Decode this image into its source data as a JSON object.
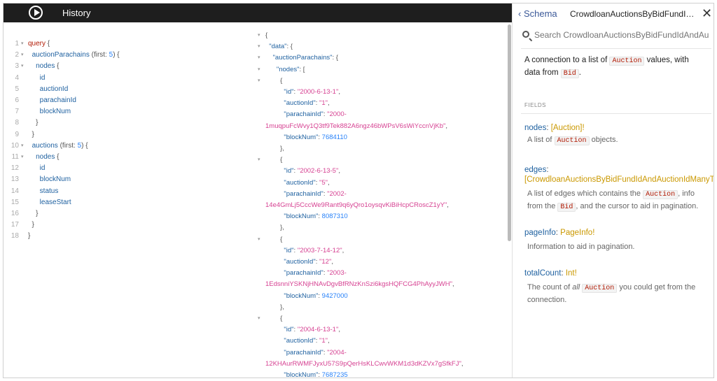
{
  "toolbar": {
    "history_label": "History"
  },
  "query_lines": [
    {
      "n": "1",
      "fold": "▾",
      "parts": [
        [
          "kw",
          "query"
        ],
        [
          "punct",
          " {"
        ]
      ]
    },
    {
      "n": "2",
      "fold": "▾",
      "parts": [
        [
          "punct",
          "  "
        ],
        [
          "field",
          "auctionParachains"
        ],
        [
          "punct",
          " (first: "
        ],
        [
          "num",
          "5"
        ],
        [
          "punct",
          ") {"
        ]
      ]
    },
    {
      "n": "3",
      "fold": "▾",
      "parts": [
        [
          "punct",
          "    "
        ],
        [
          "field",
          "nodes"
        ],
        [
          "punct",
          " {"
        ]
      ]
    },
    {
      "n": "4",
      "fold": "",
      "parts": [
        [
          "punct",
          "      "
        ],
        [
          "field",
          "id"
        ]
      ]
    },
    {
      "n": "5",
      "fold": "",
      "parts": [
        [
          "punct",
          "      "
        ],
        [
          "field",
          "auctionId"
        ]
      ]
    },
    {
      "n": "6",
      "fold": "",
      "parts": [
        [
          "punct",
          "      "
        ],
        [
          "field",
          "parachainId"
        ]
      ]
    },
    {
      "n": "7",
      "fold": "",
      "parts": [
        [
          "punct",
          "      "
        ],
        [
          "field",
          "blockNum"
        ]
      ]
    },
    {
      "n": "8",
      "fold": "",
      "parts": [
        [
          "punct",
          "    }"
        ]
      ]
    },
    {
      "n": "9",
      "fold": "",
      "parts": [
        [
          "punct",
          "  }"
        ]
      ]
    },
    {
      "n": "10",
      "fold": "▾",
      "parts": [
        [
          "punct",
          "  "
        ],
        [
          "field",
          "auctions"
        ],
        [
          "punct",
          " (first: "
        ],
        [
          "num",
          "5"
        ],
        [
          "punct",
          ") {"
        ]
      ]
    },
    {
      "n": "11",
      "fold": "▾",
      "parts": [
        [
          "punct",
          "    "
        ],
        [
          "field",
          "nodes"
        ],
        [
          "punct",
          " {"
        ]
      ]
    },
    {
      "n": "12",
      "fold": "",
      "parts": [
        [
          "punct",
          "      "
        ],
        [
          "field",
          "id"
        ]
      ]
    },
    {
      "n": "13",
      "fold": "",
      "parts": [
        [
          "punct",
          "      "
        ],
        [
          "field",
          "blockNum"
        ]
      ]
    },
    {
      "n": "14",
      "fold": "",
      "parts": [
        [
          "punct",
          "      "
        ],
        [
          "field",
          "status"
        ]
      ]
    },
    {
      "n": "15",
      "fold": "",
      "parts": [
        [
          "punct",
          "      "
        ],
        [
          "field",
          "leaseStart"
        ]
      ]
    },
    {
      "n": "16",
      "fold": "",
      "parts": [
        [
          "punct",
          "    }"
        ]
      ]
    },
    {
      "n": "17",
      "fold": "",
      "parts": [
        [
          "punct",
          "  }"
        ]
      ]
    },
    {
      "n": "18",
      "fold": "",
      "parts": [
        [
          "punct",
          "}"
        ]
      ]
    }
  ],
  "result_lines": [
    {
      "fold": "▾",
      "parts": [
        [
          "p",
          "{"
        ]
      ]
    },
    {
      "fold": "▾",
      "parts": [
        [
          "p",
          "  "
        ],
        [
          "key",
          "\"data\""
        ],
        [
          "p",
          ": {"
        ]
      ]
    },
    {
      "fold": "▾",
      "parts": [
        [
          "p",
          "    "
        ],
        [
          "key",
          "\"auctionParachains\""
        ],
        [
          "p",
          ": {"
        ]
      ]
    },
    {
      "fold": "▾",
      "parts": [
        [
          "p",
          "      "
        ],
        [
          "key",
          "\"nodes\""
        ],
        [
          "p",
          ": ["
        ]
      ]
    },
    {
      "fold": "▾",
      "parts": [
        [
          "p",
          "        {"
        ]
      ]
    },
    {
      "fold": "",
      "parts": [
        [
          "p",
          "          "
        ],
        [
          "key",
          "\"id\""
        ],
        [
          "p",
          ": "
        ],
        [
          "str",
          "\"2000-6-13-1\""
        ],
        [
          "p",
          ","
        ]
      ]
    },
    {
      "fold": "",
      "parts": [
        [
          "p",
          "          "
        ],
        [
          "key",
          "\"auctionId\""
        ],
        [
          "p",
          ": "
        ],
        [
          "str",
          "\"1\""
        ],
        [
          "p",
          ","
        ]
      ]
    },
    {
      "fold": "",
      "parts": [
        [
          "p",
          "          "
        ],
        [
          "key",
          "\"parachainId\""
        ],
        [
          "p",
          ": "
        ],
        [
          "str",
          "\"2000-"
        ]
      ]
    },
    {
      "fold": "",
      "parts": [
        [
          "str",
          "1muqpuFcWvy1Q3tf9Tek882A6ngz46bWPsV6sWiYccnVjKb\""
        ],
        [
          "p",
          ","
        ]
      ]
    },
    {
      "fold": "",
      "parts": [
        [
          "p",
          "          "
        ],
        [
          "key",
          "\"blockNum\""
        ],
        [
          "p",
          ": "
        ],
        [
          "num",
          "7684110"
        ]
      ]
    },
    {
      "fold": "",
      "parts": [
        [
          "p",
          "        },"
        ]
      ]
    },
    {
      "fold": "▾",
      "parts": [
        [
          "p",
          "        {"
        ]
      ]
    },
    {
      "fold": "",
      "parts": [
        [
          "p",
          "          "
        ],
        [
          "key",
          "\"id\""
        ],
        [
          "p",
          ": "
        ],
        [
          "str",
          "\"2002-6-13-5\""
        ],
        [
          "p",
          ","
        ]
      ]
    },
    {
      "fold": "",
      "parts": [
        [
          "p",
          "          "
        ],
        [
          "key",
          "\"auctionId\""
        ],
        [
          "p",
          ": "
        ],
        [
          "str",
          "\"5\""
        ],
        [
          "p",
          ","
        ]
      ]
    },
    {
      "fold": "",
      "parts": [
        [
          "p",
          "          "
        ],
        [
          "key",
          "\"parachainId\""
        ],
        [
          "p",
          ": "
        ],
        [
          "str",
          "\"2002-"
        ]
      ]
    },
    {
      "fold": "",
      "parts": [
        [
          "str",
          "14e4GmLj5CccWe9Rant9q6yQro1oysqvKiBiHcpCRoscZ1yY\""
        ],
        [
          "p",
          ","
        ]
      ]
    },
    {
      "fold": "",
      "parts": [
        [
          "p",
          "          "
        ],
        [
          "key",
          "\"blockNum\""
        ],
        [
          "p",
          ": "
        ],
        [
          "num",
          "8087310"
        ]
      ]
    },
    {
      "fold": "",
      "parts": [
        [
          "p",
          "        },"
        ]
      ]
    },
    {
      "fold": "▾",
      "parts": [
        [
          "p",
          "        {"
        ]
      ]
    },
    {
      "fold": "",
      "parts": [
        [
          "p",
          "          "
        ],
        [
          "key",
          "\"id\""
        ],
        [
          "p",
          ": "
        ],
        [
          "str",
          "\"2003-7-14-12\""
        ],
        [
          "p",
          ","
        ]
      ]
    },
    {
      "fold": "",
      "parts": [
        [
          "p",
          "          "
        ],
        [
          "key",
          "\"auctionId\""
        ],
        [
          "p",
          ": "
        ],
        [
          "str",
          "\"12\""
        ],
        [
          "p",
          ","
        ]
      ]
    },
    {
      "fold": "",
      "parts": [
        [
          "p",
          "          "
        ],
        [
          "key",
          "\"parachainId\""
        ],
        [
          "p",
          ": "
        ],
        [
          "str",
          "\"2003-"
        ]
      ]
    },
    {
      "fold": "",
      "parts": [
        [
          "str",
          "1EdsnniYSKNjHNAvDgvBfRNzKnSzi6kgsHQFCG4PhAyyJWH\""
        ],
        [
          "p",
          ","
        ]
      ]
    },
    {
      "fold": "",
      "parts": [
        [
          "p",
          "          "
        ],
        [
          "key",
          "\"blockNum\""
        ],
        [
          "p",
          ": "
        ],
        [
          "num",
          "9427000"
        ]
      ]
    },
    {
      "fold": "",
      "parts": [
        [
          "p",
          "        },"
        ]
      ]
    },
    {
      "fold": "▾",
      "parts": [
        [
          "p",
          "        {"
        ]
      ]
    },
    {
      "fold": "",
      "parts": [
        [
          "p",
          "          "
        ],
        [
          "key",
          "\"id\""
        ],
        [
          "p",
          ": "
        ],
        [
          "str",
          "\"2004-6-13-1\""
        ],
        [
          "p",
          ","
        ]
      ]
    },
    {
      "fold": "",
      "parts": [
        [
          "p",
          "          "
        ],
        [
          "key",
          "\"auctionId\""
        ],
        [
          "p",
          ": "
        ],
        [
          "str",
          "\"1\""
        ],
        [
          "p",
          ","
        ]
      ]
    },
    {
      "fold": "",
      "parts": [
        [
          "p",
          "          "
        ],
        [
          "key",
          "\"parachainId\""
        ],
        [
          "p",
          ": "
        ],
        [
          "str",
          "\"2004-"
        ]
      ]
    },
    {
      "fold": "",
      "parts": [
        [
          "str",
          "12KHAurRWMFJyxU57S9pQerHsKLCwvWKM1d3dKZVx7gSfkFJ\""
        ],
        [
          "p",
          ","
        ]
      ]
    },
    {
      "fold": "",
      "parts": [
        [
          "p",
          "          "
        ],
        [
          "key",
          "\"blockNum\""
        ],
        [
          "p",
          ": "
        ],
        [
          "num",
          "7687235"
        ]
      ]
    }
  ],
  "docs": {
    "back_label": "Schema",
    "title": "CrowdloanAuctionsByBidFundIdAn...",
    "search_placeholder": "Search CrowdloanAuctionsByBidFundIdAndAu",
    "desc_pre": "A connection to a list of ",
    "desc_code1": "Auction",
    "desc_mid": " values, with data from ",
    "desc_code2": "Bid",
    "desc_post": ".",
    "fields_heading": "FIELDS",
    "fields": [
      {
        "name": "nodes",
        "sep": ": ",
        "type": "[Auction]!",
        "desc_parts": [
          [
            "t",
            "A list of "
          ],
          [
            "c",
            "Auction"
          ],
          [
            "t",
            " objects."
          ]
        ]
      },
      {
        "name": "edges",
        "sep": ":",
        "type": "[CrowdloanAuctionsByBidFundIdAndAuctionIdManyToM",
        "desc_parts": [
          [
            "t",
            "A list of edges which contains the "
          ],
          [
            "c",
            "Auction"
          ],
          [
            "t",
            ", info from the "
          ],
          [
            "c",
            "Bid"
          ],
          [
            "t",
            ", and the cursor to aid in pagination."
          ]
        ]
      },
      {
        "name": "pageInfo",
        "sep": ": ",
        "type": "PageInfo!",
        "desc_parts": [
          [
            "t",
            "Information to aid in pagination."
          ]
        ]
      },
      {
        "name": "totalCount",
        "sep": ": ",
        "type": "Int!",
        "desc_parts": [
          [
            "t",
            "The count of "
          ],
          [
            "i",
            "all"
          ],
          [
            "t",
            " "
          ],
          [
            "c",
            "Auction"
          ],
          [
            "t",
            " you could get from the connection."
          ]
        ]
      }
    ]
  }
}
